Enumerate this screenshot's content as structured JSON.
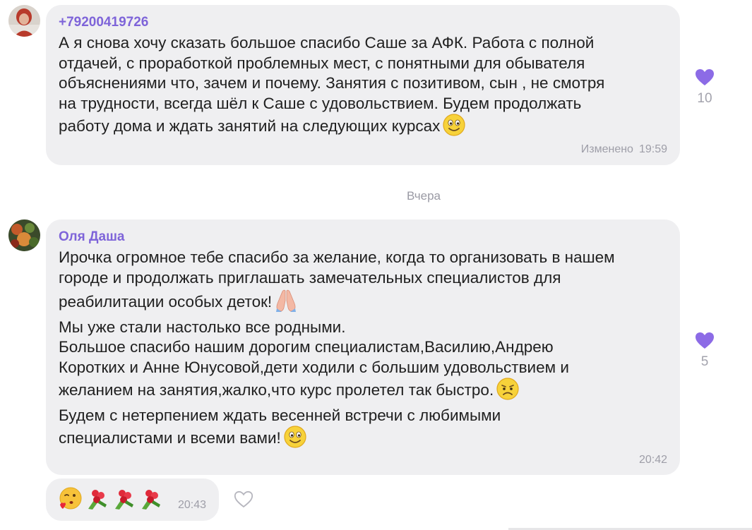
{
  "messages": [
    {
      "sender": "+79200419726",
      "text": "А я снова хочу сказать большое спасибо Саше за АФК. Работа с полной\nотдачей, с проработкой проблемных мест, с понятными для обывателя\nобъяснениями что, зачем и почему. Занятия с позитивом, сын , не смотря\nна трудности, всегда шёл к Саше с удовольствием. Будем продолжать\nработу дома и ждать занятий на следующих курсах",
      "edited": "Изменено",
      "time": "19:59",
      "likes": "10"
    },
    {
      "sender": "Оля Даша",
      "lines": [
        "Ирочка огромное тебе спасибо за желание, когда то организовать в нашем\nгороде и продолжать приглашать замечательных специалистов для\nреабилитации особых деток!",
        "Мы уже стали настолько все родными.\nБольшое спасибо нашим дорогим специалистам,Василию,Андрею\nКоротких и Анне Юнусовой,дети ходили с большим удовольствием и\nжеланием на занятия,жалко,что  курс пролетел так быстро.",
        "Будем с нетерпением ждать весенней встречи с любимыми\nспециалистами и всеми вами!"
      ],
      "time": "20:42",
      "likes": "5"
    },
    {
      "time": "20:43",
      "emojis": [
        "kiss-face-emoji",
        "bouquet-emoji",
        "bouquet-emoji",
        "bouquet-emoji"
      ]
    }
  ],
  "date_separator": "Вчера",
  "colors": {
    "accent": "#7e64d9",
    "bubble": "#efeff1",
    "heart": "#8c6be6",
    "meta": "#9e9ea8"
  },
  "icons": [
    "avatar-1",
    "avatar-2",
    "heart-icon",
    "heart-outline-icon",
    "smile-emoji",
    "praying-hands-emoji",
    "sad-face-emoji"
  ]
}
